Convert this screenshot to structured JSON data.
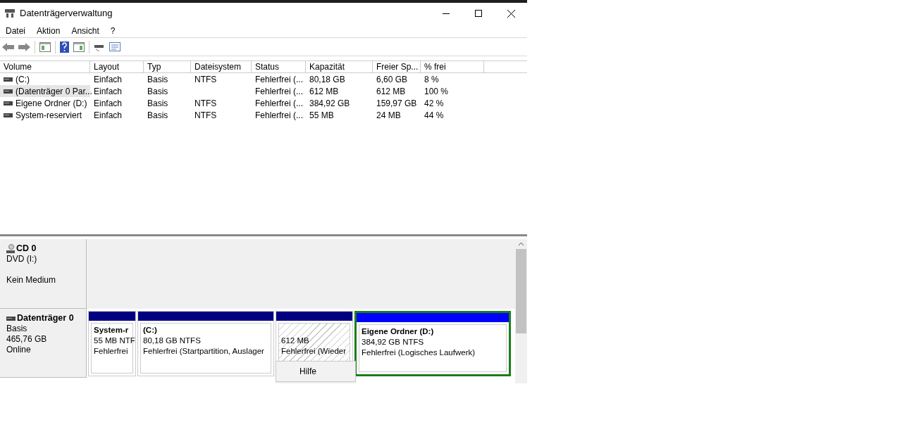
{
  "window": {
    "title": "Datenträgerverwaltung"
  },
  "menu": [
    "Datei",
    "Aktion",
    "Ansicht",
    "?"
  ],
  "table": {
    "columns": [
      "Volume",
      "Layout",
      "Typ",
      "Dateisystem",
      "Status",
      "Kapazität",
      "Freier Sp...",
      "% frei"
    ],
    "rows": [
      {
        "selected": false,
        "cells": [
          "(C:)",
          "Einfach",
          "Basis",
          "NTFS",
          "Fehlerfrei (...",
          "80,18 GB",
          "6,60 GB",
          "8 %"
        ]
      },
      {
        "selected": true,
        "cells": [
          "(Datenträger 0 Par...",
          "Einfach",
          "Basis",
          "",
          "Fehlerfrei (...",
          "612 MB",
          "612 MB",
          "100 %"
        ]
      },
      {
        "selected": false,
        "cells": [
          "Eigene Ordner  (D:)",
          "Einfach",
          "Basis",
          "NTFS",
          "Fehlerfrei (...",
          "384,92 GB",
          "159,97 GB",
          "42 %"
        ]
      },
      {
        "selected": false,
        "cells": [
          "System-reserviert",
          "Einfach",
          "Basis",
          "NTFS",
          "Fehlerfrei (...",
          "55 MB",
          "24 MB",
          "44 %"
        ]
      }
    ]
  },
  "disks": [
    {
      "kind": "cd",
      "name": "CD 0",
      "lines": [
        "DVD (I:)"
      ],
      "status": "Kein Medium"
    },
    {
      "kind": "disk",
      "name": "Datenträger 0",
      "lines": [
        "Basis",
        "465,76 GB",
        "Online"
      ],
      "partitions": [
        {
          "kind": "primary",
          "selected": false,
          "title": "System-r",
          "lines": [
            "55 MB NTF",
            "Fehlerfrei"
          ]
        },
        {
          "kind": "primary",
          "selected": false,
          "title": "(C:)",
          "lines": [
            "80,18 GB NTFS",
            "Fehlerfrei (Startpartition, Auslager"
          ]
        },
        {
          "kind": "unallocated",
          "selected": false,
          "lines": [
            "612 MB",
            "Fehlerfrei (Wieder"
          ]
        },
        {
          "kind": "logical",
          "selected": true,
          "title": "Eigene Ordner   (D:)",
          "lines": [
            "384,92 GB NTFS",
            "Fehlerfrei (Logisches Laufwerk)"
          ]
        }
      ]
    }
  ],
  "context_menu": [
    "Hilfe"
  ]
}
